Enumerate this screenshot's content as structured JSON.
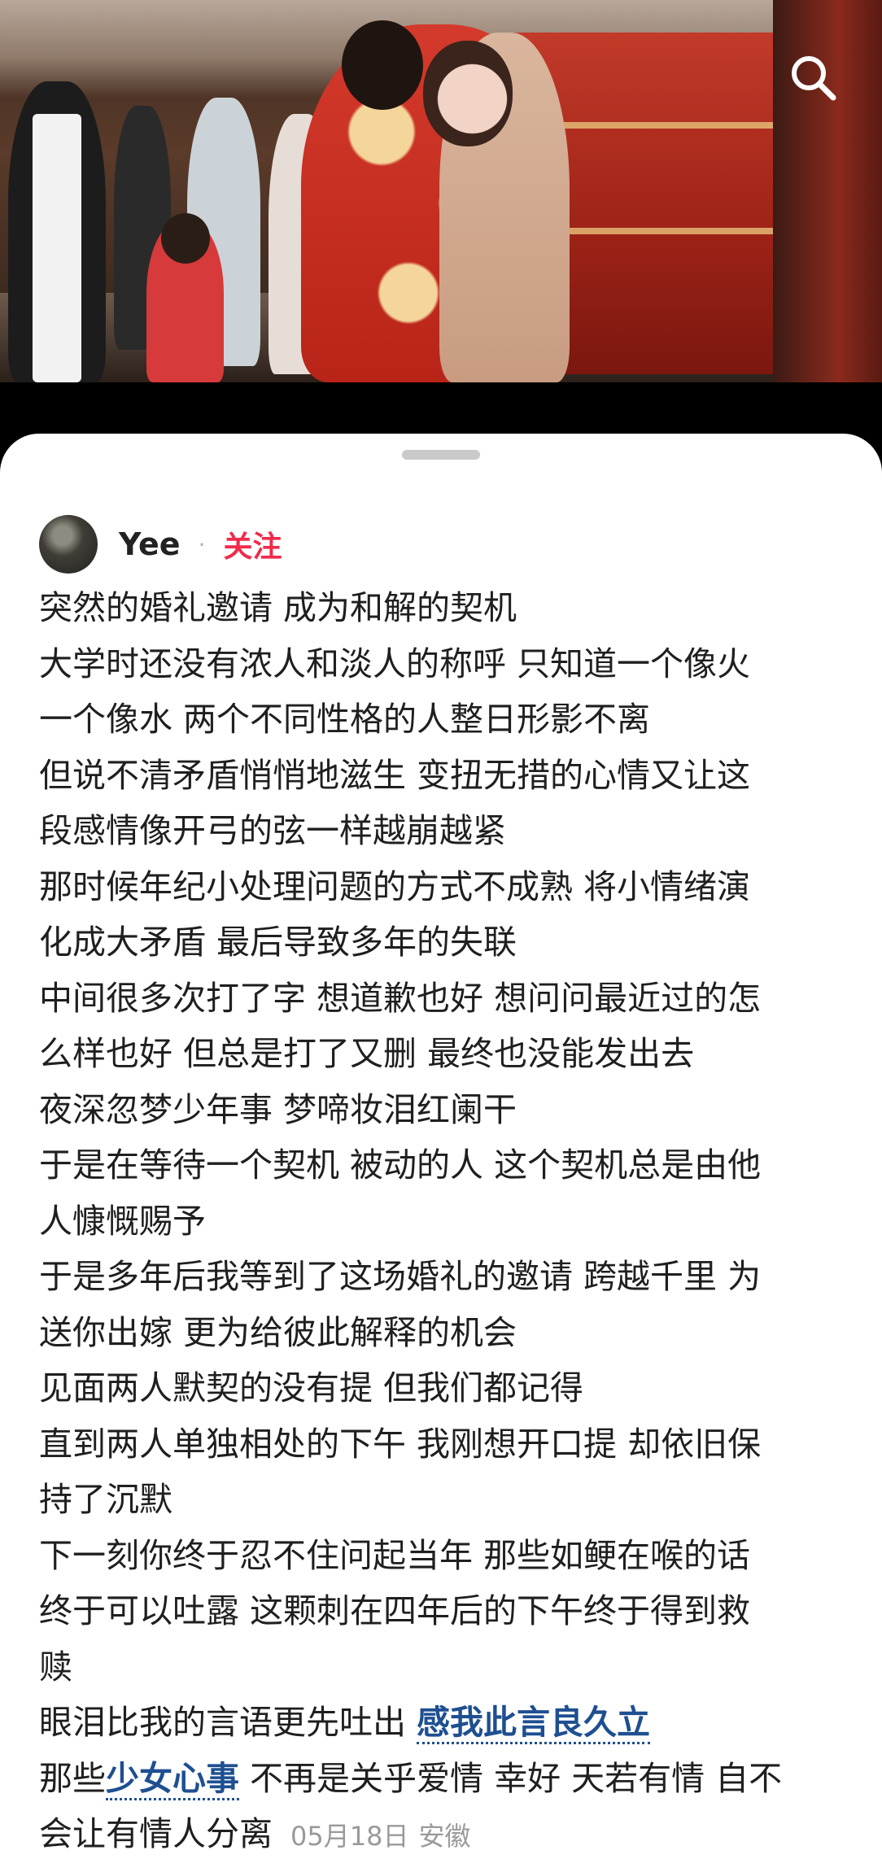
{
  "post": {
    "author": "Yee",
    "follow_label": "关注",
    "separator": "·",
    "lines": [
      "突然的婚礼邀请 成为和解的契机",
      "大学时还没有浓人和淡人的称呼 只知道一个像火",
      "一个像水 两个不同性格的人整日形影不离",
      "但说不清矛盾悄悄地滋生 变扭无措的心情又让这",
      "段感情像开弓的弦一样越崩越紧",
      "那时候年纪小处理问题的方式不成熟 将小情绪演",
      "化成大矛盾 最后导致多年的失联",
      "中间很多次打了字 想道歉也好 想问问最近过的怎",
      "么样也好 但总是打了又删 最终也没能发出去",
      "夜深忽梦少年事 梦啼妆泪红阑干",
      "于是在等待一个契机 被动的人 这个契机总是由他",
      "人慷慨赐予",
      "于是多年后我等到了这场婚礼的邀请 跨越千里 为",
      "送你出嫁 更为给彼此解释的机会",
      "见面两人默契的没有提 但我们都记得",
      "直到两人单独相处的下午 我刚想开口提 却依旧保",
      "持了沉默",
      "下一刻你终于忍不住问起当年 那些如鲠在喉的话",
      "终于可以吐露 这颗刺在四年后的下午终于得到救",
      "赎"
    ],
    "line21_text": "眼泪比我的言语更先吐出",
    "line21_link": "感我此言良久立",
    "line22_prefix": "那些",
    "line22_link": "少女心事",
    "line22_text": "不再是关乎爱情 幸好 天若有情 自不",
    "line23_text": "会让有情人分离",
    "date": "05月18日",
    "location": "安徽"
  },
  "icons": {
    "search": "search-icon"
  }
}
